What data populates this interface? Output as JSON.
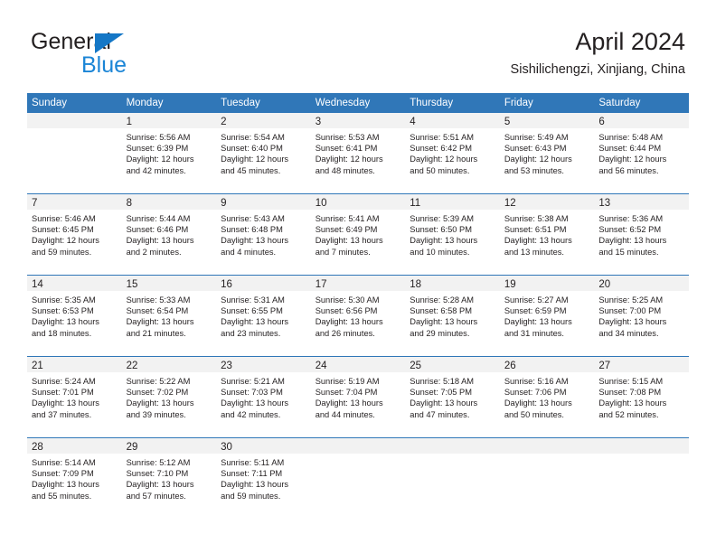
{
  "brand": {
    "name_dark": "General",
    "name_light": "Blue",
    "logo_icon": "triangle-icon",
    "accent_color": "#1b85d6"
  },
  "header": {
    "title": "April 2024",
    "subtitle": "Sishilichengzi, Xinjiang, China"
  },
  "theme": {
    "header_blue": "#3077b8",
    "day_band_gray": "#f2f2f2",
    "text_color": "#231f20"
  },
  "weekdays": [
    "Sunday",
    "Monday",
    "Tuesday",
    "Wednesday",
    "Thursday",
    "Friday",
    "Saturday"
  ],
  "weeks": [
    [
      {
        "day": "",
        "lines": []
      },
      {
        "day": "1",
        "lines": [
          "Sunrise: 5:56 AM",
          "Sunset: 6:39 PM",
          "Daylight: 12 hours",
          "and 42 minutes."
        ]
      },
      {
        "day": "2",
        "lines": [
          "Sunrise: 5:54 AM",
          "Sunset: 6:40 PM",
          "Daylight: 12 hours",
          "and 45 minutes."
        ]
      },
      {
        "day": "3",
        "lines": [
          "Sunrise: 5:53 AM",
          "Sunset: 6:41 PM",
          "Daylight: 12 hours",
          "and 48 minutes."
        ]
      },
      {
        "day": "4",
        "lines": [
          "Sunrise: 5:51 AM",
          "Sunset: 6:42 PM",
          "Daylight: 12 hours",
          "and 50 minutes."
        ]
      },
      {
        "day": "5",
        "lines": [
          "Sunrise: 5:49 AM",
          "Sunset: 6:43 PM",
          "Daylight: 12 hours",
          "and 53 minutes."
        ]
      },
      {
        "day": "6",
        "lines": [
          "Sunrise: 5:48 AM",
          "Sunset: 6:44 PM",
          "Daylight: 12 hours",
          "and 56 minutes."
        ]
      }
    ],
    [
      {
        "day": "7",
        "lines": [
          "Sunrise: 5:46 AM",
          "Sunset: 6:45 PM",
          "Daylight: 12 hours",
          "and 59 minutes."
        ]
      },
      {
        "day": "8",
        "lines": [
          "Sunrise: 5:44 AM",
          "Sunset: 6:46 PM",
          "Daylight: 13 hours",
          "and 2 minutes."
        ]
      },
      {
        "day": "9",
        "lines": [
          "Sunrise: 5:43 AM",
          "Sunset: 6:48 PM",
          "Daylight: 13 hours",
          "and 4 minutes."
        ]
      },
      {
        "day": "10",
        "lines": [
          "Sunrise: 5:41 AM",
          "Sunset: 6:49 PM",
          "Daylight: 13 hours",
          "and 7 minutes."
        ]
      },
      {
        "day": "11",
        "lines": [
          "Sunrise: 5:39 AM",
          "Sunset: 6:50 PM",
          "Daylight: 13 hours",
          "and 10 minutes."
        ]
      },
      {
        "day": "12",
        "lines": [
          "Sunrise: 5:38 AM",
          "Sunset: 6:51 PM",
          "Daylight: 13 hours",
          "and 13 minutes."
        ]
      },
      {
        "day": "13",
        "lines": [
          "Sunrise: 5:36 AM",
          "Sunset: 6:52 PM",
          "Daylight: 13 hours",
          "and 15 minutes."
        ]
      }
    ],
    [
      {
        "day": "14",
        "lines": [
          "Sunrise: 5:35 AM",
          "Sunset: 6:53 PM",
          "Daylight: 13 hours",
          "and 18 minutes."
        ]
      },
      {
        "day": "15",
        "lines": [
          "Sunrise: 5:33 AM",
          "Sunset: 6:54 PM",
          "Daylight: 13 hours",
          "and 21 minutes."
        ]
      },
      {
        "day": "16",
        "lines": [
          "Sunrise: 5:31 AM",
          "Sunset: 6:55 PM",
          "Daylight: 13 hours",
          "and 23 minutes."
        ]
      },
      {
        "day": "17",
        "lines": [
          "Sunrise: 5:30 AM",
          "Sunset: 6:56 PM",
          "Daylight: 13 hours",
          "and 26 minutes."
        ]
      },
      {
        "day": "18",
        "lines": [
          "Sunrise: 5:28 AM",
          "Sunset: 6:58 PM",
          "Daylight: 13 hours",
          "and 29 minutes."
        ]
      },
      {
        "day": "19",
        "lines": [
          "Sunrise: 5:27 AM",
          "Sunset: 6:59 PM",
          "Daylight: 13 hours",
          "and 31 minutes."
        ]
      },
      {
        "day": "20",
        "lines": [
          "Sunrise: 5:25 AM",
          "Sunset: 7:00 PM",
          "Daylight: 13 hours",
          "and 34 minutes."
        ]
      }
    ],
    [
      {
        "day": "21",
        "lines": [
          "Sunrise: 5:24 AM",
          "Sunset: 7:01 PM",
          "Daylight: 13 hours",
          "and 37 minutes."
        ]
      },
      {
        "day": "22",
        "lines": [
          "Sunrise: 5:22 AM",
          "Sunset: 7:02 PM",
          "Daylight: 13 hours",
          "and 39 minutes."
        ]
      },
      {
        "day": "23",
        "lines": [
          "Sunrise: 5:21 AM",
          "Sunset: 7:03 PM",
          "Daylight: 13 hours",
          "and 42 minutes."
        ]
      },
      {
        "day": "24",
        "lines": [
          "Sunrise: 5:19 AM",
          "Sunset: 7:04 PM",
          "Daylight: 13 hours",
          "and 44 minutes."
        ]
      },
      {
        "day": "25",
        "lines": [
          "Sunrise: 5:18 AM",
          "Sunset: 7:05 PM",
          "Daylight: 13 hours",
          "and 47 minutes."
        ]
      },
      {
        "day": "26",
        "lines": [
          "Sunrise: 5:16 AM",
          "Sunset: 7:06 PM",
          "Daylight: 13 hours",
          "and 50 minutes."
        ]
      },
      {
        "day": "27",
        "lines": [
          "Sunrise: 5:15 AM",
          "Sunset: 7:08 PM",
          "Daylight: 13 hours",
          "and 52 minutes."
        ]
      }
    ],
    [
      {
        "day": "28",
        "lines": [
          "Sunrise: 5:14 AM",
          "Sunset: 7:09 PM",
          "Daylight: 13 hours",
          "and 55 minutes."
        ]
      },
      {
        "day": "29",
        "lines": [
          "Sunrise: 5:12 AM",
          "Sunset: 7:10 PM",
          "Daylight: 13 hours",
          "and 57 minutes."
        ]
      },
      {
        "day": "30",
        "lines": [
          "Sunrise: 5:11 AM",
          "Sunset: 7:11 PM",
          "Daylight: 13 hours",
          "and 59 minutes."
        ]
      },
      {
        "day": "",
        "lines": []
      },
      {
        "day": "",
        "lines": []
      },
      {
        "day": "",
        "lines": []
      },
      {
        "day": "",
        "lines": []
      }
    ]
  ]
}
